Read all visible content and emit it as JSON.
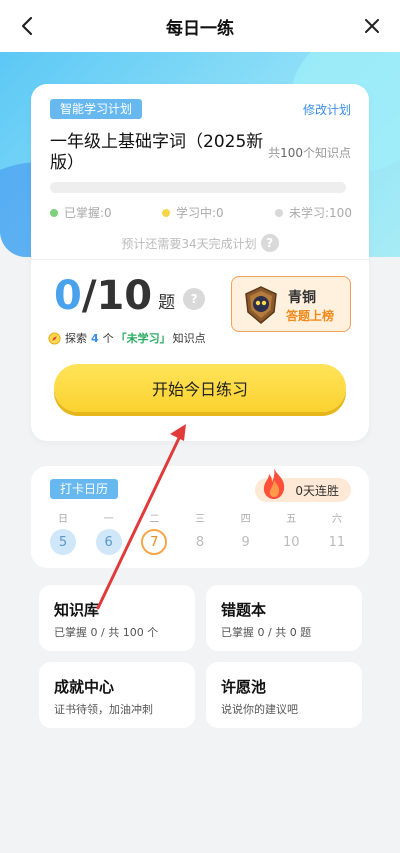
{
  "header": {
    "title": "每日一练"
  },
  "plan": {
    "tag": "智能学习计划",
    "modify": "修改计划",
    "title": "一年级上基础字词（2025新版）",
    "count_prefix": "共",
    "count": "100",
    "count_suffix": "个知识点",
    "progress": 0,
    "legend": {
      "mastered": "已掌握:0",
      "learning": "学习中:0",
      "unlearned": "未学习:100"
    },
    "estimate": "预计还需要34天完成计划"
  },
  "goal": {
    "done": "0",
    "total": "/10",
    "unit": "题",
    "explore_prefix": "探索",
    "explore_count": "4",
    "explore_mid": "个",
    "explore_highlight": "「未学习」",
    "explore_suffix": "知识点"
  },
  "rank": {
    "name": "青铜",
    "sub": "答题上榜"
  },
  "start_button": "开始今日练习",
  "checkin": {
    "tag": "打卡日历",
    "streak": "0天连胜",
    "weekdays": [
      "日",
      "一",
      "二",
      "三",
      "四",
      "五",
      "六"
    ],
    "dates": [
      "5",
      "6",
      "7",
      "8",
      "9",
      "10",
      "11"
    ]
  },
  "tiles": {
    "knowledge": {
      "title": "知识库",
      "sub": "已掌握 0 / 共 100 个"
    },
    "mistakes": {
      "title": "错题本",
      "sub": "已掌握 0 / 共 0 题"
    },
    "achievement": {
      "title": "成就中心",
      "sub": "证书待领，加油冲刺"
    },
    "wish": {
      "title": "许愿池",
      "sub": "说说你的建议吧"
    }
  },
  "colors": {
    "accent": "#4aa2ec",
    "tag_bg": "#67b8ef",
    "button": "#fbd22f",
    "today_ring": "#f4a74a",
    "annotation_arrow": "#e03a3a"
  }
}
